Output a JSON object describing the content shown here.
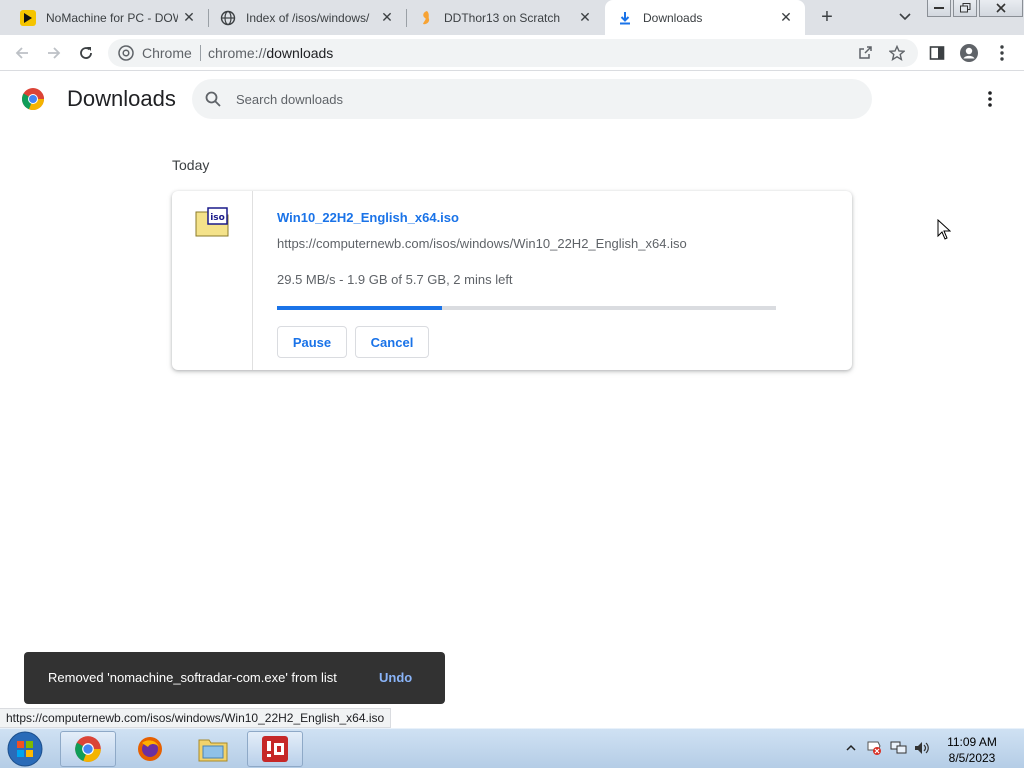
{
  "browser": {
    "tabs": [
      {
        "title": "NoMachine for PC - DOW",
        "icon": "nomachine-icon",
        "active": false
      },
      {
        "title": "Index of /isos/windows/",
        "icon": "globe-icon",
        "active": false
      },
      {
        "title": "DDThor13 on Scratch",
        "icon": "scratch-icon",
        "active": false
      },
      {
        "title": "Downloads",
        "icon": "download-icon",
        "active": true
      }
    ],
    "site_label": "Chrome",
    "url_scheme": "chrome://",
    "url_path": "downloads"
  },
  "page": {
    "title": "Downloads",
    "search_placeholder": "Search downloads"
  },
  "downloads": {
    "date_heading": "Today",
    "item": {
      "file_name": "Win10_22H2_English_x64.iso",
      "url": "https://computernewb.com/isos/windows/Win10_22H2_English_x64.iso",
      "status": "29.5 MB/s - 1.9 GB of 5.7 GB, 2 mins left",
      "progress": 0.33,
      "icon_label": "iso",
      "pause_label": "Pause",
      "cancel_label": "Cancel"
    }
  },
  "toast": {
    "message": "Removed 'nomachine_softradar-com.exe' from list",
    "undo_label": "Undo"
  },
  "status_url": "https://computernewb.com/isos/windows/Win10_22H2_English_x64.iso",
  "taskbar": {
    "time": "11:09 AM",
    "date": "8/5/2023"
  },
  "colors": {
    "accent": "#1a73e8",
    "toast_bg": "#323232",
    "toast_action": "#8ab4f8"
  }
}
